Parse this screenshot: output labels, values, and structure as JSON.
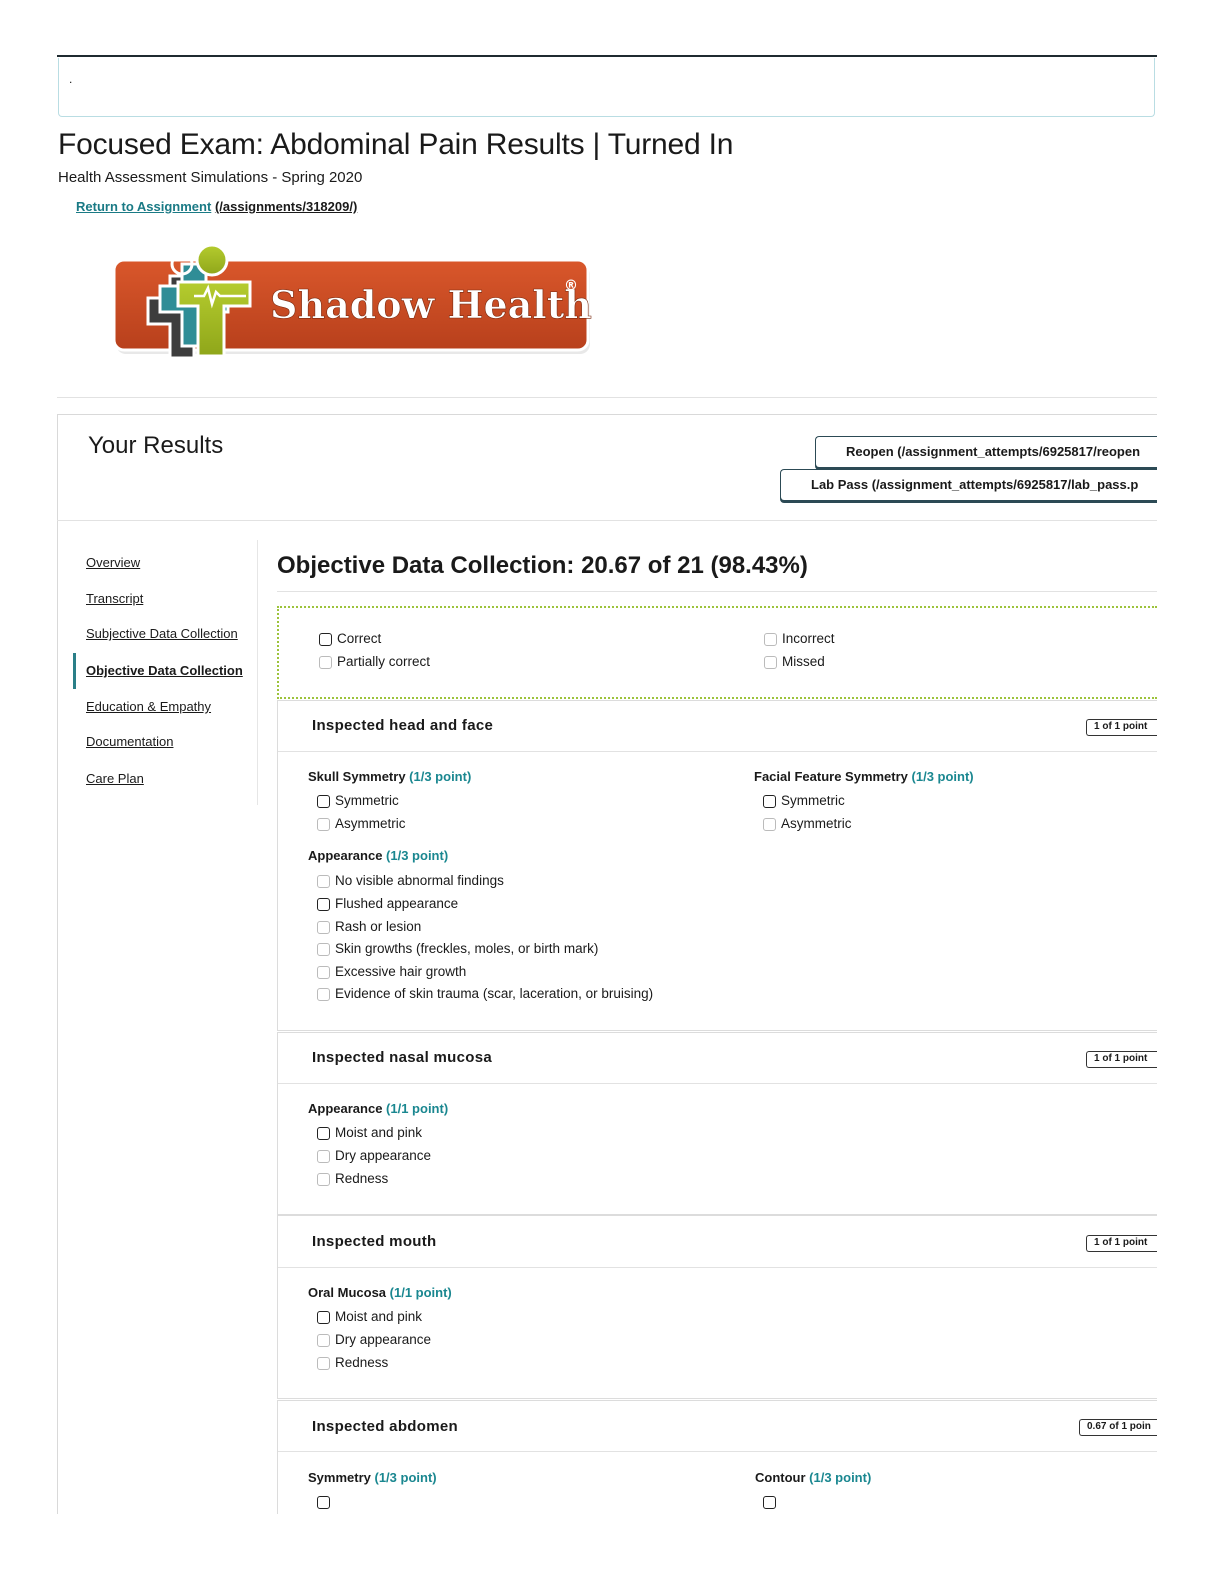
{
  "notice": ".",
  "page_title": "Focused Exam: Abdominal Pain Results | Turned In",
  "course": "Health Assessment Simulations - Spring 2020",
  "return_link": {
    "label": "Return to Assignment",
    "url": "(/assignments/318209/)"
  },
  "logo": {
    "text": "Shadow Health",
    "mark": "®",
    "icon": "shadow-health-logo"
  },
  "results": {
    "title": "Your Results",
    "reopen_button": "Reopen (/assignment_attempts/6925817/reopen",
    "labpass_button": "Lab Pass (/assignment_attempts/6925817/lab_pass.p"
  },
  "nav": {
    "items": [
      {
        "label": "Overview"
      },
      {
        "label": "Transcript"
      },
      {
        "label": "Subjective Data Collection"
      },
      {
        "label": "Objective Data Collection",
        "active": true
      },
      {
        "label": "Education & Empathy"
      },
      {
        "label": "Documentation"
      },
      {
        "label": "Care Plan"
      }
    ]
  },
  "section": {
    "title": "Objective Data Collection: 20.67 of 21 (98.43%)"
  },
  "legend": {
    "correct": "Correct",
    "incorrect": "Incorrect",
    "partial": "Partially correct",
    "missed": "Missed"
  },
  "cards": [
    {
      "title": "Inspected head and face",
      "points": "1 of 1 point",
      "groups": [
        {
          "label": "Skull Symmetry",
          "pts": "(1/3 point)",
          "options": [
            "Symmetric",
            "Asymmetric"
          ]
        },
        {
          "label": "Facial Feature Symmetry",
          "pts": "(1/3 point)",
          "options": [
            "Symmetric",
            "Asymmetric"
          ]
        },
        {
          "label": "Appearance",
          "pts": "(1/3 point)",
          "options": [
            "No visible abnormal findings",
            "Flushed appearance",
            "Rash or lesion",
            "Skin growths (freckles, moles, or birth mark)",
            "Excessive hair growth",
            "Evidence of skin trauma (scar, laceration, or bruising)"
          ]
        }
      ]
    },
    {
      "title": "Inspected nasal mucosa",
      "points": "1 of 1 point",
      "groups": [
        {
          "label": "Appearance",
          "pts": "(1/1 point)",
          "options": [
            "Moist and pink",
            "Dry appearance",
            "Redness"
          ]
        }
      ]
    },
    {
      "title": "Inspected mouth",
      "points": "1 of 1 point",
      "groups": [
        {
          "label": "Oral Mucosa",
          "pts": "(1/1 point)",
          "options": [
            "Moist and pink",
            "Dry appearance",
            "Redness"
          ]
        }
      ]
    },
    {
      "title": "Inspected abdomen",
      "points": "0.67 of 1 poin",
      "groups": [
        {
          "label": "Symmetry",
          "pts": "(1/3 point)"
        },
        {
          "label": "Contour",
          "pts": "(1/3 point)"
        }
      ]
    }
  ]
}
